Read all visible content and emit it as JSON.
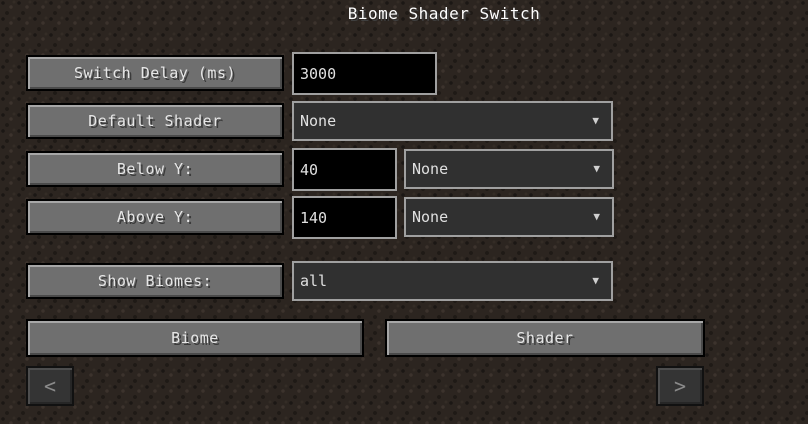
{
  "title": "Biome Shader Switch",
  "switch_delay": {
    "label": "Switch Delay (ms)",
    "value": "3000"
  },
  "default_shader": {
    "label": "Default Shader",
    "selected": "None"
  },
  "below_y": {
    "label": "Below Y:",
    "value": "40",
    "selected": "None"
  },
  "above_y": {
    "label": "Above Y:",
    "value": "140",
    "selected": "None"
  },
  "show_biomes": {
    "label": "Show Biomes:",
    "selected": "all"
  },
  "columns": {
    "biome": "Biome",
    "shader": "Shader"
  },
  "nav": {
    "prev": "<",
    "next": ">"
  },
  "dropdown_arrow": "▼"
}
